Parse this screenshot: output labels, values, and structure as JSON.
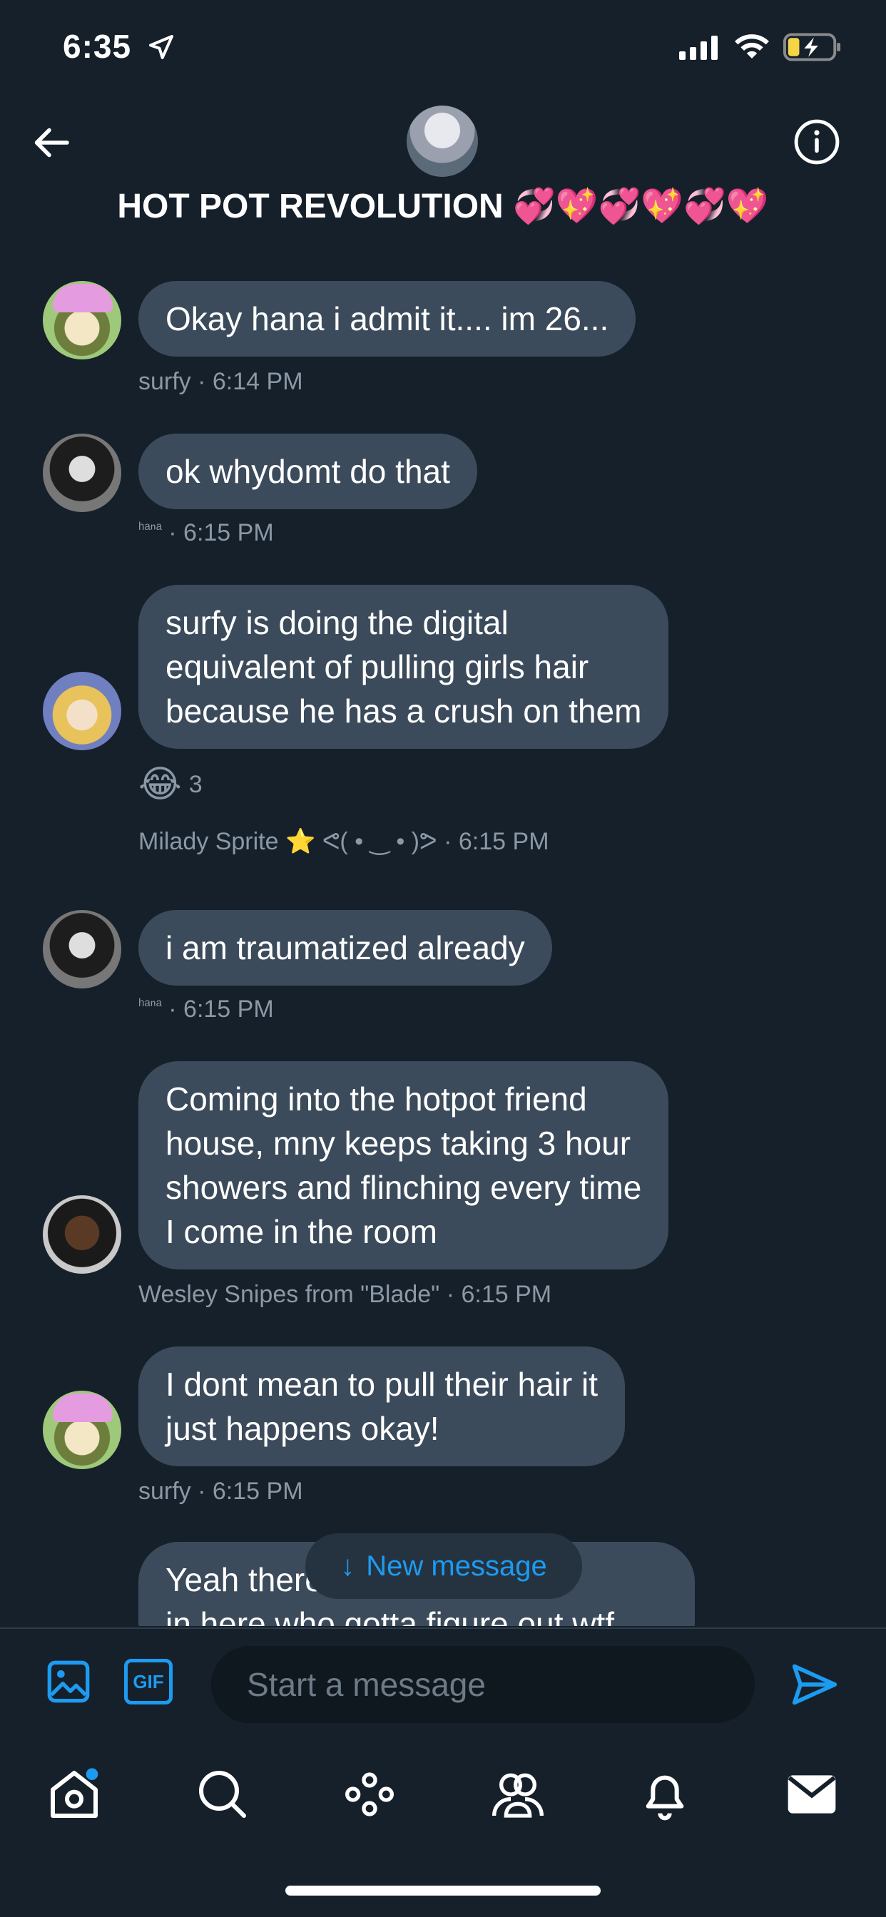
{
  "status_bar": {
    "time": "6:35"
  },
  "header": {
    "title": "HOT POT REVOLUTION 💞💖💞💖💞💖"
  },
  "messages": [
    {
      "author": "surfy",
      "text": "Okay hana i admit it.... im 26...",
      "meta": "surfy · 6:14 PM"
    },
    {
      "author_small": "ʰᵃⁿᵃ",
      "text": "ok whydomt do that",
      "meta": " · 6:15 PM"
    },
    {
      "author": "Milady Sprite",
      "lines": [
        "surfy is doing the digital",
        "equivalent of pulling girls hair",
        "because he has a crush on them"
      ],
      "reaction_emoji": "😂",
      "reaction_count": "3",
      "meta": "Milady Sprite ⭐ ᕙ( • ‿ • )ᕗ · 6:15 PM"
    },
    {
      "author_small": "ʰᵃⁿᵃ",
      "text": "i am traumatized already",
      "meta": " · 6:15 PM"
    },
    {
      "author": "Wesley Snipes from \"Blade\"",
      "lines": [
        "Coming into the hotpot friend",
        "house, mny keeps taking 3 hour",
        "showers and flinching every time",
        "I come in the room"
      ],
      "meta": "Wesley Snipes from \"Blade\"  · 6:15 PM"
    },
    {
      "author": "surfy",
      "lines": [
        "I dont mean to pull their hair it",
        "just happens okay!"
      ],
      "meta": "surfy · 6:15 PM"
    },
    {
      "author": "",
      "lines": [
        "Yeah there are a lot of you",
        "in here who gotta figure out wtf"
      ]
    }
  ],
  "new_message": {
    "arrow": "↓",
    "label": "New message"
  },
  "compose": {
    "gif_label": "GIF",
    "placeholder": "Start a message"
  },
  "tabbar": {
    "items": [
      "home",
      "search",
      "communities",
      "spaces",
      "notifications",
      "messages"
    ]
  },
  "colors": {
    "background": "#15202b",
    "bubble": "#3c4b5b",
    "accent": "#1d9bf0",
    "meta": "#8b98a5"
  }
}
